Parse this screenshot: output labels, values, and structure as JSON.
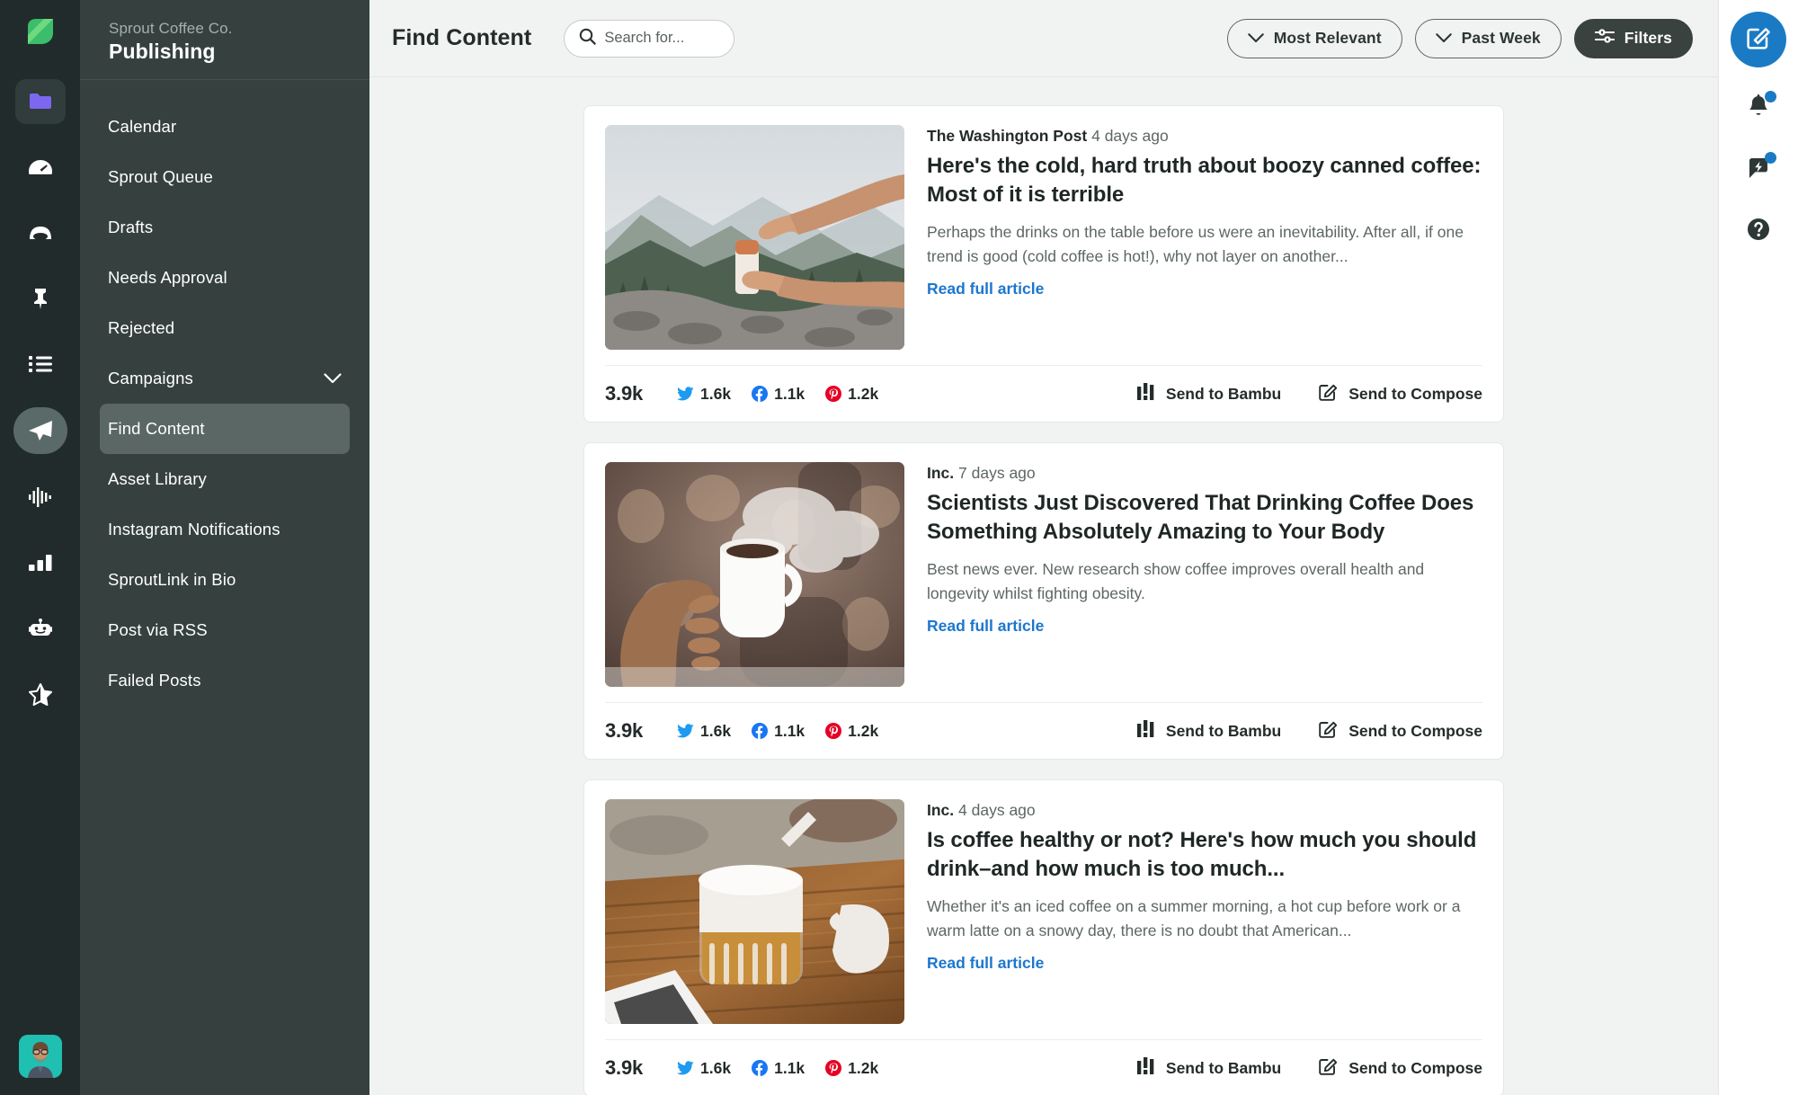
{
  "rail": {
    "logo_icon": "sprout-leaf-logo",
    "items": [
      {
        "icon": "folder-icon",
        "name": "messages",
        "state": "boxed"
      },
      {
        "icon": "gauge-icon",
        "name": "dashboard",
        "state": "normal"
      },
      {
        "icon": "inbox-icon",
        "name": "smart-inbox",
        "state": "normal"
      },
      {
        "icon": "pin-icon",
        "name": "tasks",
        "state": "normal"
      },
      {
        "icon": "list-icon",
        "name": "feeds",
        "state": "normal"
      },
      {
        "icon": "paper-plane-icon",
        "name": "publishing",
        "state": "active"
      },
      {
        "icon": "pulse-icon",
        "name": "listening",
        "state": "normal"
      },
      {
        "icon": "bar-chart-icon",
        "name": "reports",
        "state": "normal"
      },
      {
        "icon": "bot-icon",
        "name": "bots",
        "state": "normal"
      },
      {
        "icon": "star-half-icon",
        "name": "reviews",
        "state": "normal"
      }
    ],
    "avatar_name": "user-avatar"
  },
  "sidebar": {
    "org": "Sprout Coffee Co.",
    "title": "Publishing",
    "items": [
      {
        "label": "Calendar",
        "selected": false,
        "chevron": false
      },
      {
        "label": "Sprout Queue",
        "selected": false,
        "chevron": false
      },
      {
        "label": "Drafts",
        "selected": false,
        "chevron": false
      },
      {
        "label": "Needs Approval",
        "selected": false,
        "chevron": false
      },
      {
        "label": "Rejected",
        "selected": false,
        "chevron": false
      },
      {
        "label": "Campaigns",
        "selected": false,
        "chevron": true
      },
      {
        "label": "Find Content",
        "selected": true,
        "chevron": false
      },
      {
        "label": "Asset Library",
        "selected": false,
        "chevron": false
      },
      {
        "label": "Instagram Notifications",
        "selected": false,
        "chevron": false
      },
      {
        "label": "SproutLink in Bio",
        "selected": false,
        "chevron": false
      },
      {
        "label": "Post via RSS",
        "selected": false,
        "chevron": false
      },
      {
        "label": "Failed Posts",
        "selected": false,
        "chevron": false
      }
    ]
  },
  "topbar": {
    "page_title": "Find Content",
    "search": {
      "value": "",
      "placeholder": "Search for...",
      "icon": "search-icon"
    },
    "sort_label": "Most Relevant",
    "date_label": "Past Week",
    "filters_label": "Filters"
  },
  "right_rail": {
    "compose_icon": "compose-pencil-icon",
    "notifications_icon": "bell-icon",
    "whats_new_icon": "megaphone-bolt-icon",
    "help_icon": "question-circle-icon",
    "accent": "#1a7bc4"
  },
  "labels": {
    "read_full_article": "Read full article",
    "send_to_bambu": "Send to Bambu",
    "send_to_compose": "Send to Compose"
  },
  "colors": {
    "twitter": "#1d9bf0",
    "facebook": "#1877f2",
    "pinterest": "#e60023",
    "link": "#1c76cf",
    "sidebar_bg": "#36413f",
    "rail_bg": "#222b2b"
  },
  "cards": [
    {
      "source": "The Washington Post",
      "time": "4 days ago",
      "headline": "Here's the cold, hard truth about boozy canned coffee: Most of it is terrible",
      "summary": "Perhaps the drinks on the table before us were an inevitability. After all, if one trend is good (cold coffee is hot!), why not layer on another...",
      "image": "hands-opening-can-in-mountains",
      "shares_total": "3.9k",
      "stats": [
        {
          "network": "twitter",
          "value": "1.6k"
        },
        {
          "network": "facebook",
          "value": "1.1k"
        },
        {
          "network": "pinterest",
          "value": "1.2k"
        }
      ]
    },
    {
      "source": "Inc.",
      "time": "7 days ago",
      "headline": "Scientists Just Discovered That Drinking Coffee Does Something Absolutely Amazing to Your Body",
      "summary": "Best news ever. New research show coffee improves overall health and longevity whilst fighting obesity.",
      "image": "hand-holding-steaming-mug",
      "shares_total": "3.9k",
      "stats": [
        {
          "network": "twitter",
          "value": "1.6k"
        },
        {
          "network": "facebook",
          "value": "1.1k"
        },
        {
          "network": "pinterest",
          "value": "1.2k"
        }
      ]
    },
    {
      "source": "Inc.",
      "time": "4 days ago",
      "headline": "Is coffee healthy or not? Here's how much you should drink–and how much is too much...",
      "summary": "Whether it's an iced coffee on a summer morning, a hot cup before work or a warm latte on a snowy day, there is no doubt that American...",
      "image": "latte-glass-on-wood-table",
      "shares_total": "3.9k",
      "stats": [
        {
          "network": "twitter",
          "value": "1.6k"
        },
        {
          "network": "facebook",
          "value": "1.1k"
        },
        {
          "network": "pinterest",
          "value": "1.2k"
        }
      ]
    }
  ]
}
